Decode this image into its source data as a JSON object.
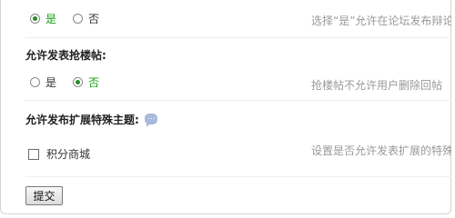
{
  "section1": {
    "options": [
      {
        "label": "是",
        "selected": true
      },
      {
        "label": "否",
        "selected": false
      }
    ],
    "hint": "选择“是”允许在论坛发布辩论"
  },
  "section2": {
    "title": "允许发表抢楼帖:",
    "options": [
      {
        "label": "是",
        "selected": false
      },
      {
        "label": "否",
        "selected": true
      }
    ],
    "hint": "抢楼帖不允许用户删除回帖"
  },
  "section3": {
    "title": "允许发布扩展特殊主题:",
    "checkbox_label": "积分商城",
    "hint": "设置是否允许发表扩展的特殊"
  },
  "submit_label": "提交"
}
